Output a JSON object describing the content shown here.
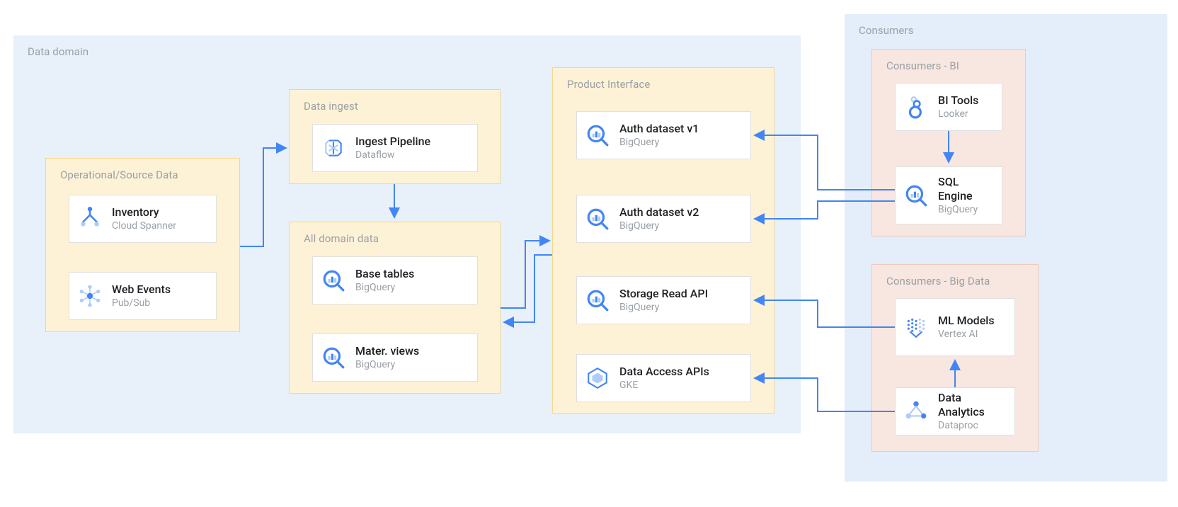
{
  "domain": {
    "label": "Data domain",
    "source": {
      "label": "Operational/Source Data",
      "cards": {
        "inventory": {
          "title": "Inventory",
          "sub": "Cloud Spanner"
        },
        "webevents": {
          "title": "Web Events",
          "sub": "Pub/Sub"
        }
      }
    },
    "ingest": {
      "label": "Data ingest",
      "pipeline": {
        "title": "Ingest Pipeline",
        "sub": "Dataflow"
      }
    },
    "alldata": {
      "label": "All domain data",
      "base": {
        "title": "Base tables",
        "sub": "BigQuery"
      },
      "mview": {
        "title": "Mater. views",
        "sub": "BigQuery"
      }
    },
    "product": {
      "label": "Product Interface",
      "auth1": {
        "title": "Auth dataset v1",
        "sub": "BigQuery"
      },
      "auth2": {
        "title": "Auth dataset v2",
        "sub": "BigQuery"
      },
      "storage": {
        "title": "Storage Read API",
        "sub": "BigQuery"
      },
      "dapi": {
        "title": "Data Access APIs",
        "sub": "GKE"
      }
    }
  },
  "consumers": {
    "label": "Consumers",
    "bi": {
      "label": "Consumers - BI",
      "bitools": {
        "title": "BI Tools",
        "sub": "Looker"
      },
      "sql": {
        "title": "SQL Engine",
        "sub": "BigQuery"
      }
    },
    "bigdata": {
      "label": "Consumers - Big Data",
      "ml": {
        "title": "ML Models",
        "sub": "Vertex AI"
      },
      "analytics": {
        "title": "Data Analytics",
        "sub": "Dataproc"
      }
    }
  }
}
